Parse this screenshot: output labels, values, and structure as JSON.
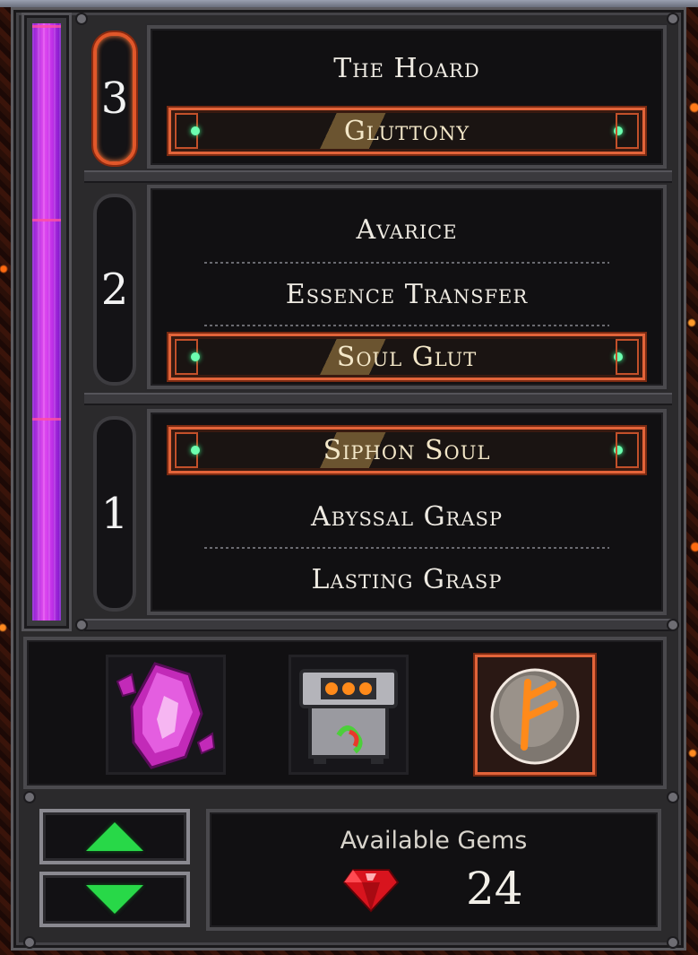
{
  "tiers": [
    {
      "number": "3",
      "active": true,
      "rows": [
        {
          "label": "The Hoard",
          "selected": false
        },
        {
          "label": "Gluttony",
          "selected": true
        }
      ]
    },
    {
      "number": "2",
      "active": false,
      "rows": [
        {
          "label": "Avarice",
          "selected": false
        },
        {
          "label": "Essence Transfer",
          "selected": false
        },
        {
          "label": "Soul Glut",
          "selected": true
        }
      ]
    },
    {
      "number": "1",
      "active": false,
      "rows": [
        {
          "label": "Siphon Soul",
          "selected": true
        },
        {
          "label": "Abyssal Grasp",
          "selected": false
        },
        {
          "label": "Lasting Grasp",
          "selected": false
        }
      ]
    }
  ],
  "items": [
    {
      "icon": "pink-crystal-icon",
      "selected": false
    },
    {
      "icon": "furnace-machine-icon",
      "selected": false
    },
    {
      "icon": "rune-stone-icon",
      "selected": true
    }
  ],
  "gems": {
    "label": "Available Gems",
    "count": "24",
    "icon": "red-gem-icon"
  },
  "colors": {
    "accent": "#e2643a",
    "meter": "#d040f0",
    "arrow": "#28d848",
    "gem": "#e01828"
  }
}
